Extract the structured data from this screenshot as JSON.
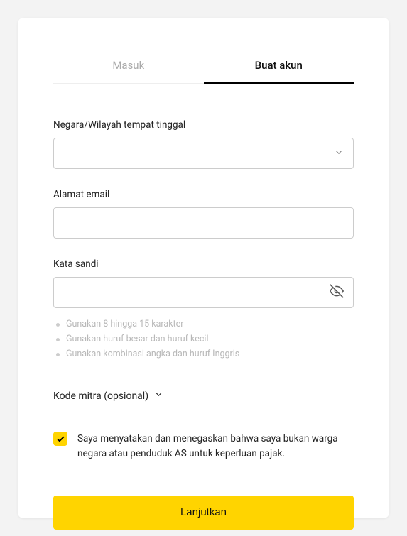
{
  "tabs": {
    "login": "Masuk",
    "signup": "Buat akun"
  },
  "country": {
    "label": "Negara/Wilayah tempat tinggal",
    "value": ""
  },
  "email": {
    "label": "Alamat email",
    "value": ""
  },
  "password": {
    "label": "Kata sandi",
    "value": "",
    "hints": [
      "Gunakan 8 hingga 15 karakter",
      "Gunakan huruf besar dan huruf kecil",
      "Gunakan kombinasi angka dan huruf Inggris"
    ]
  },
  "partner": {
    "label": "Kode mitra (opsional)"
  },
  "declaration": {
    "checked": true,
    "text": "Saya menyatakan dan menegaskan bahwa saya bukan warga negara atau penduduk AS untuk keperluan pajak."
  },
  "submit": {
    "label": "Lanjutkan"
  }
}
